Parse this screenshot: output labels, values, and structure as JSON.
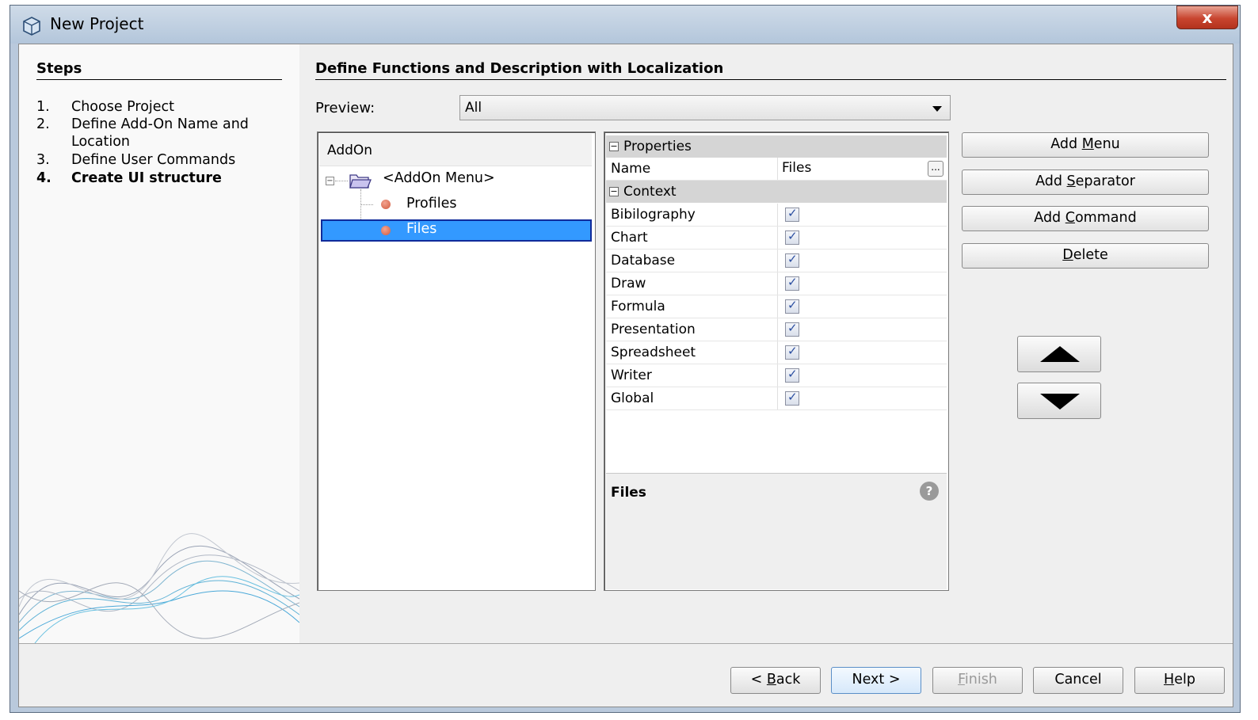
{
  "window": {
    "title": "New Project",
    "close_label": "x"
  },
  "steps": {
    "title": "Steps",
    "items": [
      {
        "num": "1.",
        "label": "Choose Project"
      },
      {
        "num": "2.",
        "label": "Define Add-On Name and Location"
      },
      {
        "num": "3.",
        "label": "Define User Commands"
      },
      {
        "num": "4.",
        "label": "Create UI structure"
      }
    ]
  },
  "main": {
    "title": "Define Functions and Description with Localization",
    "preview_label": "Preview:",
    "preview_value": "All"
  },
  "tree": {
    "header": "AddOn",
    "root": "<AddOn Menu>",
    "children": [
      "Profiles",
      "Files"
    ]
  },
  "properties": {
    "section_properties": "Properties",
    "name_key": "Name",
    "name_value": "Files",
    "name_button": "...",
    "section_context": "Context",
    "context_items": [
      "Bibilography",
      "Chart",
      "Database",
      "Draw",
      "Formula",
      "Presentation",
      "Spreadsheet",
      "Writer",
      "Global"
    ],
    "description_title": "Files",
    "help_icon": "?"
  },
  "side_buttons": {
    "add_menu_pre": "Add ",
    "add_menu_u": "M",
    "add_menu_post": "enu",
    "add_separator_pre": "Add ",
    "add_separator_u": "S",
    "add_separator_post": "eparator",
    "add_command_pre": "Add ",
    "add_command_u": "C",
    "add_command_post": "ommand",
    "delete_u": "D",
    "delete_post": "elete"
  },
  "footer": {
    "back_pre": "< ",
    "back_u": "B",
    "back_post": "ack",
    "next": "Next >",
    "finish_u": "F",
    "finish_post": "inish",
    "cancel": "Cancel",
    "help_u": "H",
    "help_post": "elp"
  },
  "colors": {
    "selection": "#3399ff",
    "selection_border": "#102b9a",
    "close_button": "#c8452f"
  }
}
